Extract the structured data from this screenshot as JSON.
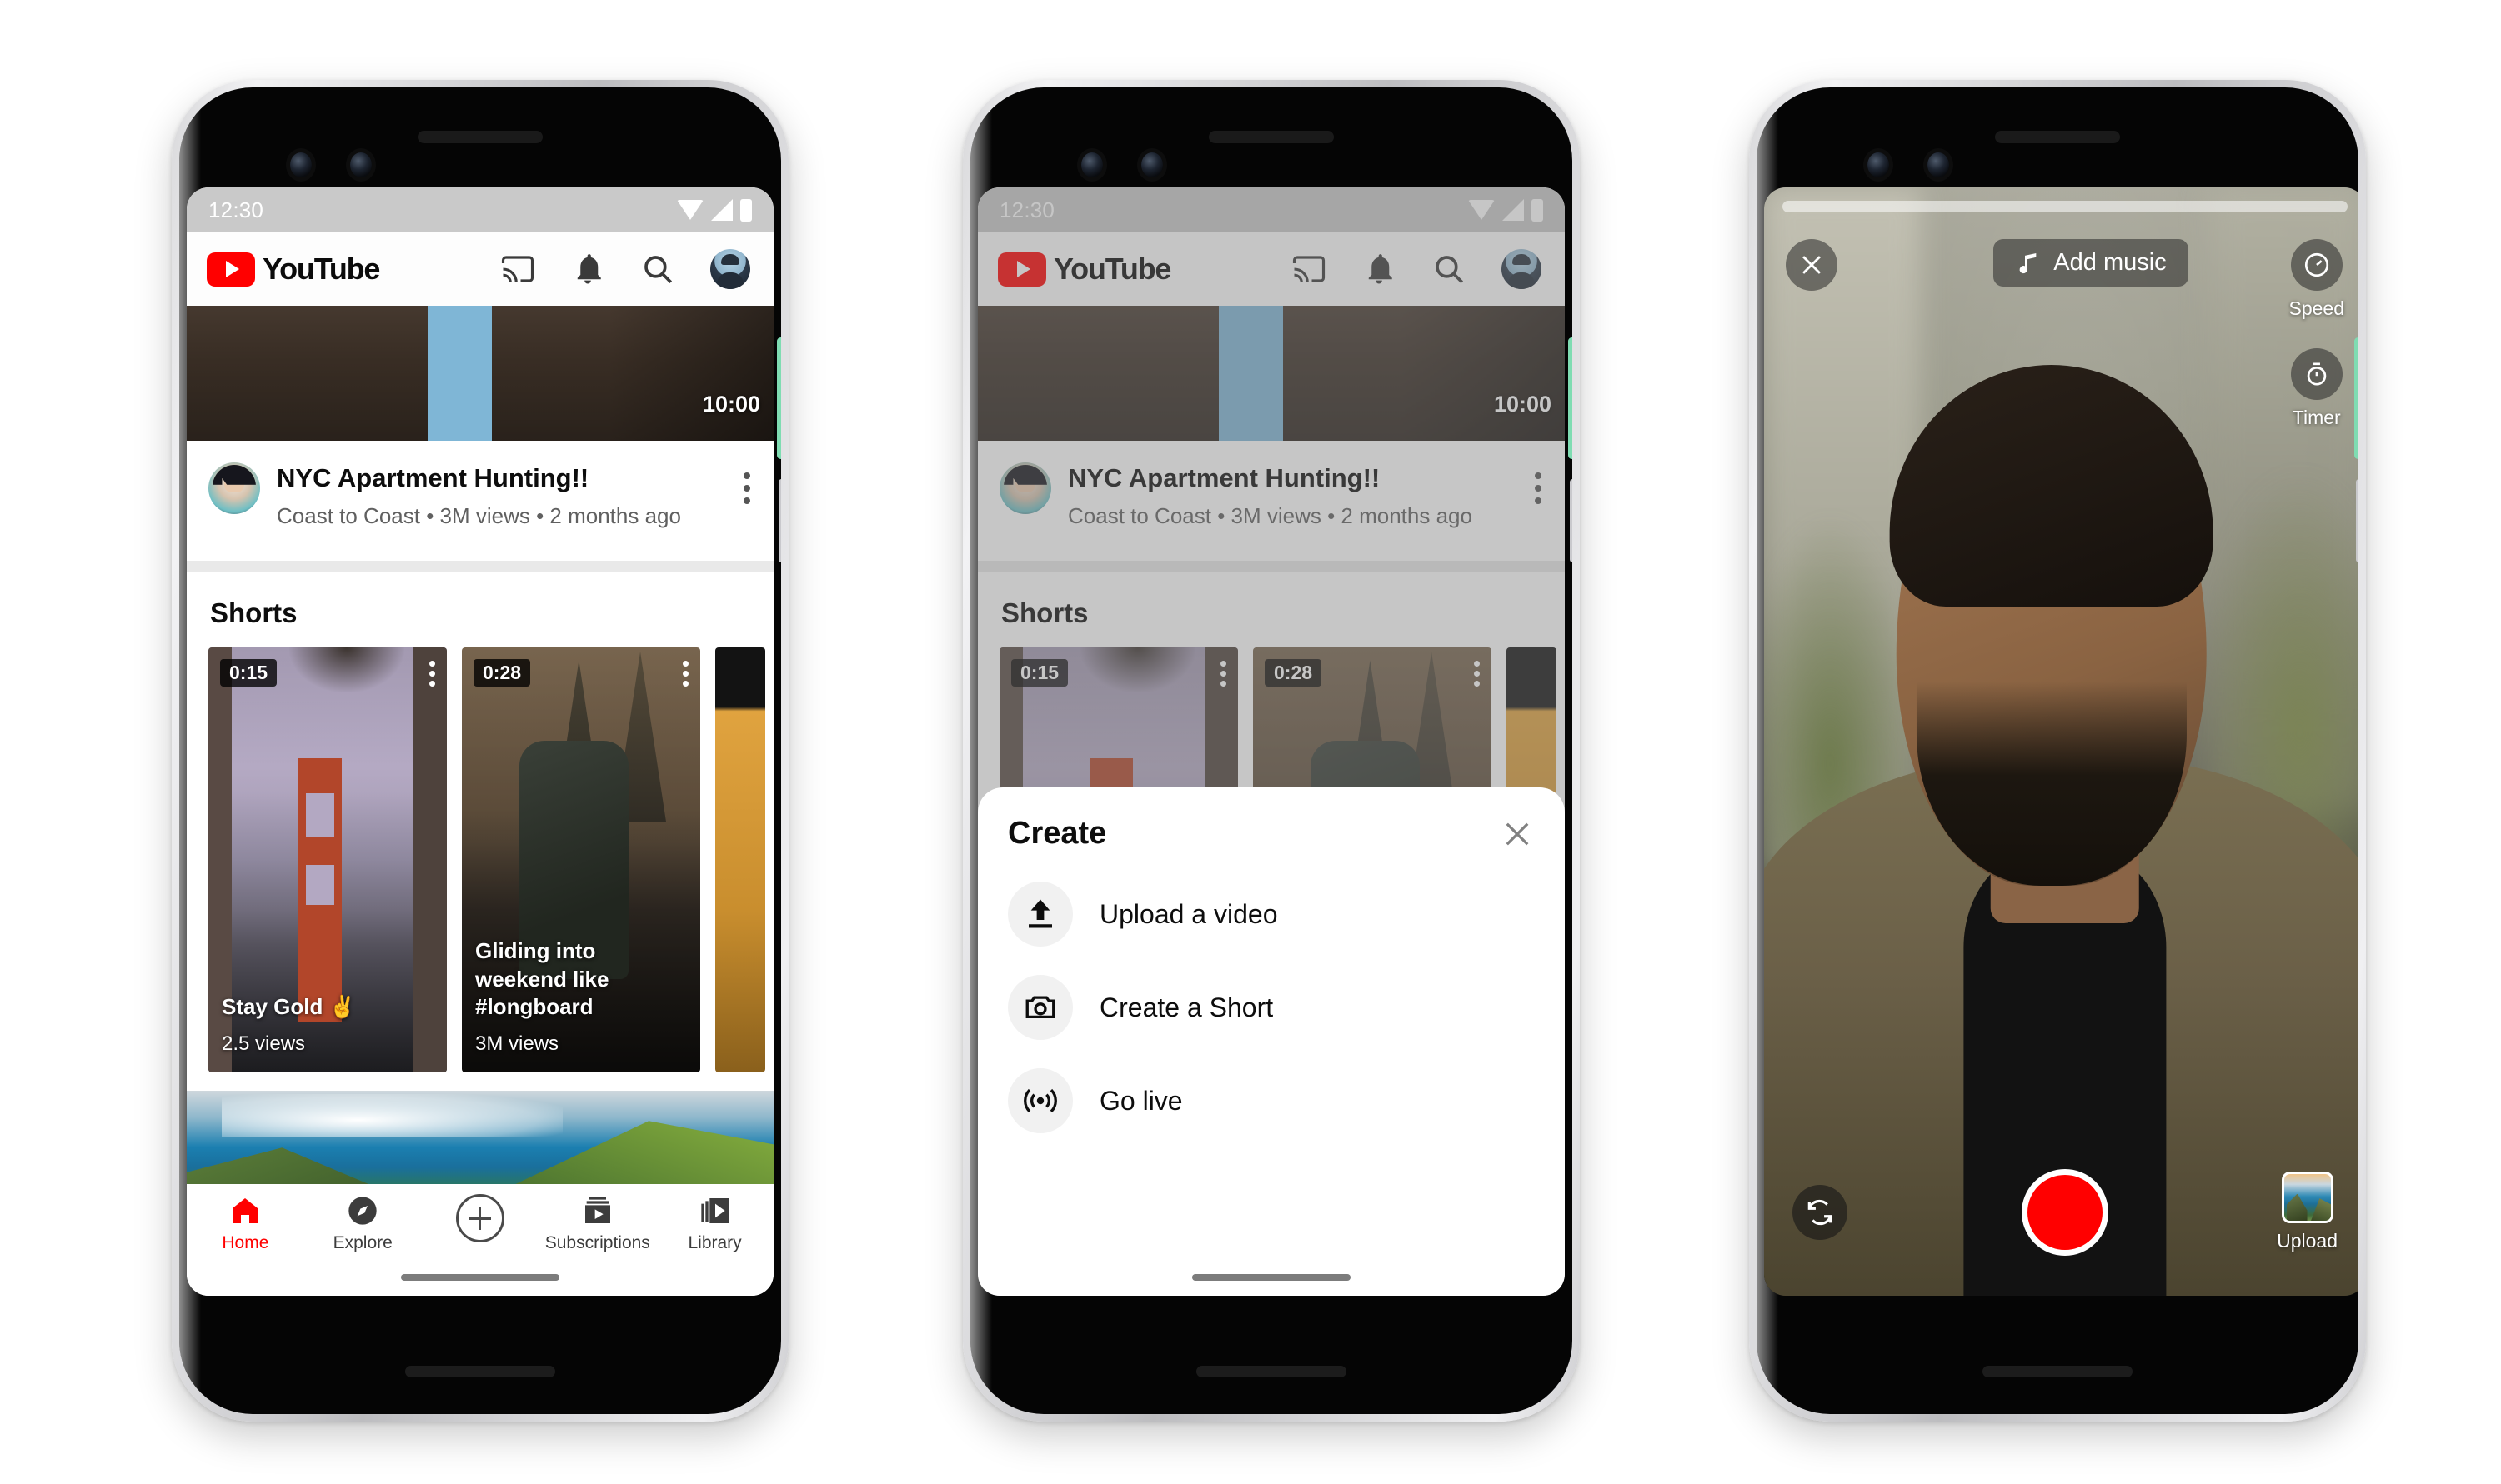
{
  "phones": [
    {
      "id": "phone-home-feed",
      "status_bar": {
        "time": "12:30",
        "icons": [
          "wifi-icon",
          "signal-icon",
          "battery-icon"
        ]
      },
      "header": {
        "logo_text": "YouTube",
        "actions": [
          "cast-icon",
          "notifications-bell-icon",
          "search-icon",
          "account-avatar"
        ]
      },
      "feed": {
        "video": {
          "duration": "10:00",
          "title": "NYC Apartment Hunting!!",
          "meta": "Coast to Coast • 3M views • 2 months ago",
          "menu": "more-options-icon"
        },
        "shorts_section_title": "Shorts",
        "shorts": [
          {
            "duration": "0:15",
            "title": "Stay Gold ✌️",
            "views": "2.5 views"
          },
          {
            "duration": "0:28",
            "title": "Gliding into weekend like #longboard",
            "views": "3M views"
          },
          {
            "duration": "",
            "title": "",
            "views": ""
          }
        ]
      },
      "bottom_nav": {
        "active": "Home",
        "items": [
          {
            "label": "Home",
            "icon": "home-icon"
          },
          {
            "label": "Explore",
            "icon": "compass-icon"
          },
          {
            "label": "",
            "icon": "create-plus-icon"
          },
          {
            "label": "Subscriptions",
            "icon": "subscriptions-icon"
          },
          {
            "label": "Library",
            "icon": "library-icon"
          }
        ]
      }
    },
    {
      "id": "phone-create-sheet",
      "status_bar": {
        "time": "12:30"
      },
      "header": {
        "logo_text": "YouTube"
      },
      "feed": {
        "video": {
          "duration": "10:00",
          "title": "NYC Apartment Hunting!!",
          "meta": "Coast to Coast • 3M views • 2 months ago"
        },
        "shorts_section_title": "Shorts",
        "shorts": [
          {
            "duration": "0:15"
          },
          {
            "duration": "0:28"
          }
        ]
      },
      "sheet": {
        "title": "Create",
        "close_icon": "close-icon",
        "options": [
          {
            "label": "Upload a video",
            "icon": "upload-icon"
          },
          {
            "label": "Create a Short",
            "icon": "camera-icon"
          },
          {
            "label": "Go live",
            "icon": "broadcast-icon"
          }
        ]
      }
    },
    {
      "id": "phone-shorts-camera",
      "camera": {
        "close_icon": "close-icon",
        "add_music_label": "Add music",
        "add_music_icon": "music-note-icon",
        "tools": [
          {
            "label": "Speed",
            "icon": "speedometer-icon"
          },
          {
            "label": "Timer",
            "icon": "stopwatch-icon"
          }
        ],
        "flip_icon": "flip-camera-icon",
        "record_button": "record-button",
        "record_color": "#ff0000",
        "upload_label": "Upload",
        "upload_icon": "gallery-thumbnail"
      }
    }
  ],
  "colors": {
    "youtube_red": "#ff0000",
    "status_bar_gray": "#c9c9c9",
    "text_primary": "#0d0d0d",
    "text_secondary": "#606060",
    "side_button_green": "#7fdcb2"
  }
}
